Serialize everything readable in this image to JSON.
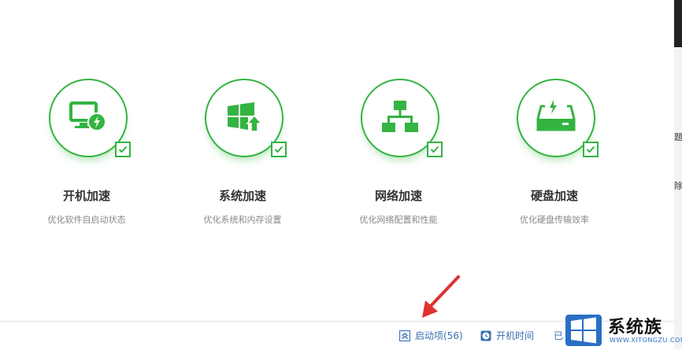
{
  "features": [
    {
      "title": "开机加速",
      "desc": "优化软件自启动状态",
      "icon": "monitor-bolt-icon"
    },
    {
      "title": "系统加速",
      "desc": "优化系统和内存设置",
      "icon": "windows-upgrade-icon"
    },
    {
      "title": "网络加速",
      "desc": "优化网络配置和性能",
      "icon": "network-topology-icon"
    },
    {
      "title": "硬盘加速",
      "desc": "优化硬盘传输效率",
      "icon": "harddisk-bolt-icon"
    }
  ],
  "statusbar": {
    "startup_items": "启动项(56)",
    "boot_time": "开机时间",
    "truncated": "已"
  },
  "side_chars": [
    "题",
    "除"
  ],
  "watermark": {
    "main": "系统族",
    "sub": "WWW.XITONGZU.COM"
  },
  "colors": {
    "accent": "#33b441",
    "link": "#3a6fb0",
    "arrow": "#e03030"
  }
}
